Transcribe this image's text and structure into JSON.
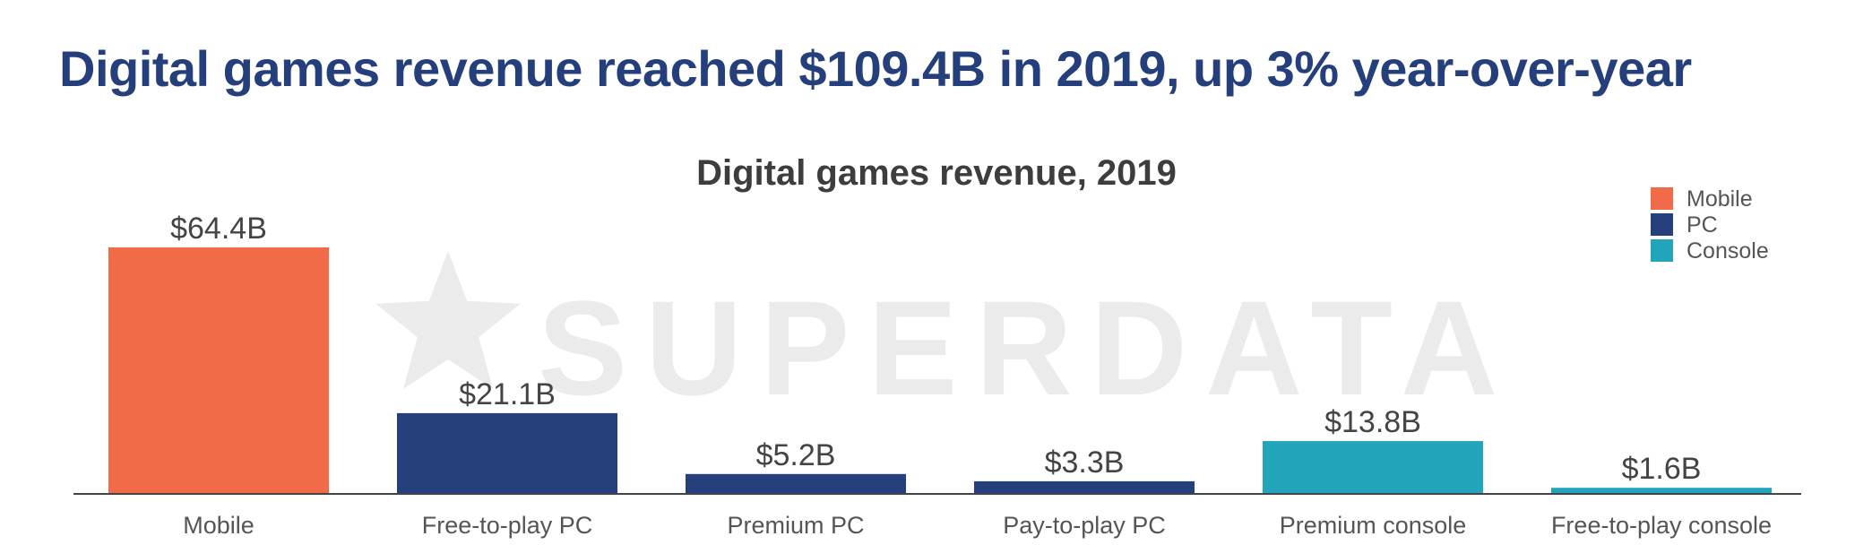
{
  "headline": "Digital games revenue reached $109.4B in 2019, up 3% year-over-year",
  "watermark": {
    "text": "SUPERDATA",
    "icon": "star-icon",
    "color": "#ebebeb"
  },
  "colors": {
    "headline": "#253f7d",
    "mobile": "#f26b49",
    "pc": "#263f7d",
    "console": "#22a4bb"
  },
  "chart_data": {
    "type": "bar",
    "title": "Digital games revenue, 2019",
    "xlabel": "",
    "ylabel": "",
    "ylim": [
      0,
      64.4
    ],
    "grid": false,
    "legend_position": "top-right",
    "categories": [
      "Mobile",
      "Free-to-play PC",
      "Premium PC",
      "Pay-to-play PC",
      "Premium console",
      "Free-to-play console"
    ],
    "values": [
      64.4,
      21.1,
      5.2,
      3.3,
      13.8,
      1.6
    ],
    "value_labels": [
      "$64.4B",
      "$21.1B",
      "$5.2B",
      "$3.3B",
      "$13.8B",
      "$1.6B"
    ],
    "bar_groups": [
      "Mobile",
      "PC",
      "PC",
      "PC",
      "Console",
      "Console"
    ],
    "legend": [
      {
        "name": "Mobile",
        "color": "#f26b49"
      },
      {
        "name": "PC",
        "color": "#263f7d"
      },
      {
        "name": "Console",
        "color": "#22a4bb"
      }
    ]
  }
}
